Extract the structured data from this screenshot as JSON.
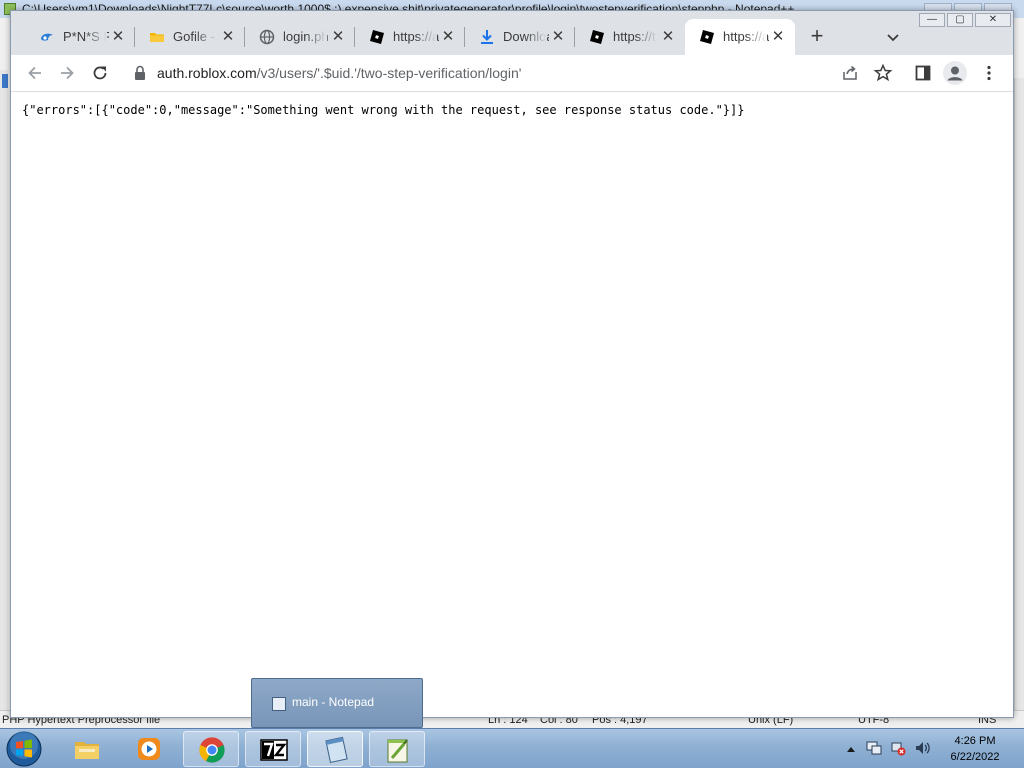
{
  "notepad_bg": {
    "title": "C:\\Users\\vm1\\Downloads\\NightT77Lc\\source\\worth 1000$ :) expensive shit\\privategenerator\\profile\\login\\twostepverification\\stepphp - Notepad++",
    "status": {
      "filetype": "PHP Hypertext Preprocessor file",
      "ln": "Ln : 124",
      "col": "Col : 80",
      "pos": "Pos : 4,197",
      "eol": "Unix (LF)",
      "encoding": "UTF-8",
      "mode": "INS"
    }
  },
  "browser": {
    "tabs": [
      {
        "label": "P*N*S R...",
        "icon": "pns-favicon",
        "active": false
      },
      {
        "label": "Gofile - F",
        "icon": "folder-favicon",
        "active": false
      },
      {
        "label": "login.php",
        "icon": "globe-favicon",
        "active": false
      },
      {
        "label": "https://a",
        "icon": "roblox-favicon",
        "active": false
      },
      {
        "label": "Download",
        "icon": "download-favicon",
        "active": false
      },
      {
        "label": "https://t",
        "icon": "roblox-favicon",
        "active": false
      },
      {
        "label": "https://a",
        "icon": "roblox-favicon",
        "active": true
      }
    ],
    "url": {
      "host": "auth.roblox.com",
      "path": "/v3/users/'.$uid.'/two-step-verification/login'"
    },
    "content_text": "{\"errors\":[{\"code\":0,\"message\":\"Something went wrong with the request, see response status code.\"}]}"
  },
  "taskbar": {
    "thumbnail_label": "main - Notepad",
    "clock_time": "4:26 PM",
    "clock_date": "6/22/2022",
    "apps": [
      "explorer",
      "media-player",
      "chrome",
      "7zip",
      "notepad",
      "notepad-plus-plus"
    ]
  },
  "colors": {
    "tabstrip": "#dee1e6",
    "taskbar": "#8fb0d3",
    "roblox": "#000000"
  }
}
